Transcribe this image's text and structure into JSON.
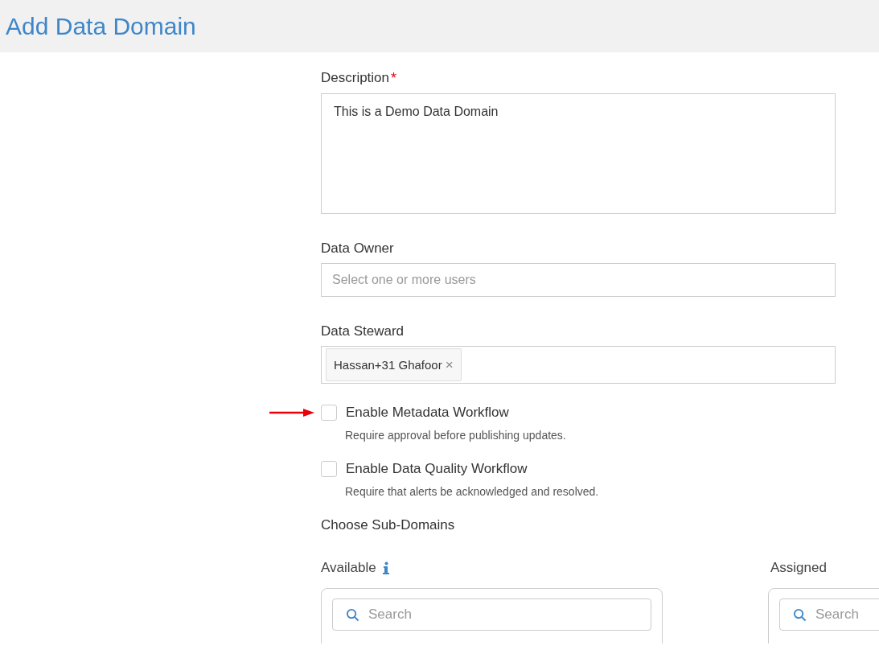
{
  "header": {
    "title": "Add Data Domain"
  },
  "description": {
    "label": "Description",
    "required_mark": "*",
    "value": "This is a Demo Data Domain"
  },
  "data_owner": {
    "label": "Data Owner",
    "placeholder": "Select one or more users"
  },
  "data_steward": {
    "label": "Data Steward",
    "tags": [
      {
        "label": "Hassan+31 Ghafoor",
        "remove": "×"
      }
    ]
  },
  "options": [
    {
      "label": "Enable Metadata Workflow",
      "hint": "Require approval before publishing updates.",
      "checked": false,
      "pointer": true
    },
    {
      "label": "Enable Data Quality Workflow",
      "hint": "Require that alerts be acknowledged and resolved.",
      "checked": false,
      "pointer": false
    }
  ],
  "sub_domains": {
    "title": "Choose Sub-Domains",
    "lists": [
      {
        "label": "Available",
        "info": true,
        "placeholder": "Search"
      },
      {
        "label": "Assigned",
        "info": false,
        "placeholder": "Search"
      }
    ]
  }
}
